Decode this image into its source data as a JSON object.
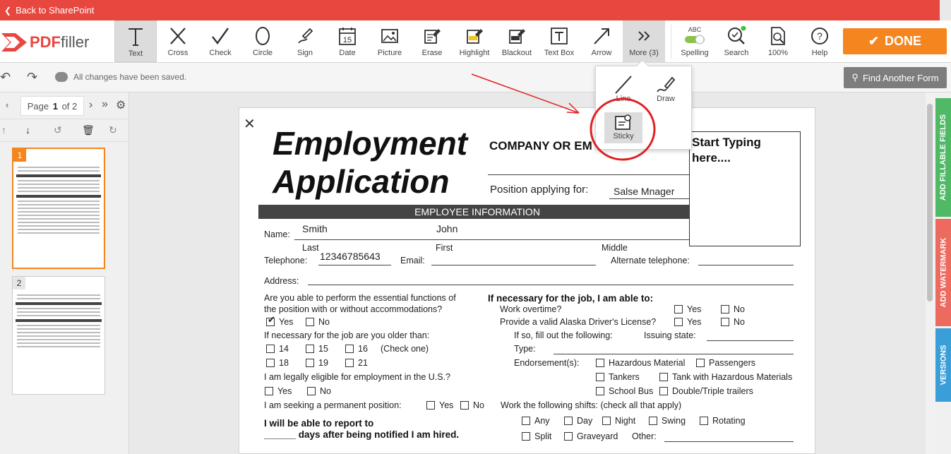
{
  "topbar": {
    "back_label": "Back to SharePoint"
  },
  "brand": {
    "pdf": "PDF",
    "filler": "filler"
  },
  "tools": [
    {
      "label": "Text",
      "icon": "text-icon"
    },
    {
      "label": "Cross",
      "icon": "cross-icon"
    },
    {
      "label": "Check",
      "icon": "check-icon"
    },
    {
      "label": "Circle",
      "icon": "circle-icon"
    },
    {
      "label": "Sign",
      "icon": "sign-icon"
    },
    {
      "label": "Date",
      "icon": "date-icon"
    },
    {
      "label": "Picture",
      "icon": "picture-icon"
    },
    {
      "label": "Erase",
      "icon": "erase-icon"
    },
    {
      "label": "Highlight",
      "icon": "highlight-icon"
    },
    {
      "label": "Blackout",
      "icon": "blackout-icon"
    },
    {
      "label": "Text Box",
      "icon": "textbox-icon"
    },
    {
      "label": "Arrow",
      "icon": "arrow-icon"
    },
    {
      "label": "More (3)",
      "icon": "more-icon"
    }
  ],
  "right_tools": [
    {
      "label": "Spelling",
      "icon": "spelling-icon",
      "badge": "ABC"
    },
    {
      "label": "Search",
      "icon": "search-icon"
    },
    {
      "label": "100%",
      "icon": "zoom-icon"
    },
    {
      "label": "Help",
      "icon": "help-icon"
    }
  ],
  "date_icon_number": "15",
  "done_label": "DONE",
  "status_text": "All changes have been saved.",
  "find_label": "Find Another Form",
  "pager": {
    "prefix": "Page",
    "current": "1",
    "suffix": "of 2"
  },
  "thumbnails": [
    {
      "num": "1"
    },
    {
      "num": "2"
    }
  ],
  "more_menu": [
    {
      "label": "Line",
      "icon": "line-icon"
    },
    {
      "label": "Draw",
      "icon": "draw-icon"
    },
    {
      "label": "Sticky",
      "icon": "sticky-icon"
    }
  ],
  "side_tabs": [
    {
      "label": "ADD FILLABLE FIELDS",
      "color": "#4fb966"
    },
    {
      "label": "ADD WATERMARK",
      "color": "#ec6a5e"
    },
    {
      "label": "VERSIONS",
      "color": "#3a9fd8"
    }
  ],
  "doc": {
    "title_line1": "Employment",
    "title_line2": "Application",
    "company_label": "COMPANY OR EM",
    "position_label": "Position applying for:",
    "position_value": "Salse Mnager",
    "typing_box": "Start Typing here....",
    "section_header": "EMPLOYEE INFORMATION",
    "name_label": "Name:",
    "last_value": "Smith",
    "first_value": "John",
    "last_label": "Last",
    "first_label": "First",
    "middle_label": "Middle",
    "telephone_label": "Telephone:",
    "telephone_value": "12346785643",
    "email_label": "Email:",
    "alt_phone_label": "Alternate telephone:",
    "address_label": "Address:",
    "q1_line1": "Are you able to perform the essential functions of",
    "q1_line2": "the position with or without accommodations?",
    "yes": "Yes",
    "no": "No",
    "q2": "If necessary for the job are you older than:",
    "ages": [
      "14",
      "15",
      "16",
      "18",
      "19",
      "21"
    ],
    "check_one": "(Check one)",
    "q3": "I am legally eligible for employment in the U.S.?",
    "q4": "I am seeking a permanent position:",
    "report_line1": "I will be able to report to",
    "report_line2": "______ days after being notified I am hired.",
    "right_header": "If necessary for the job, I am able to:",
    "overtime": "Work overtime?",
    "license": "Provide a valid Alaska Driver's License?",
    "if_so": "If so, fill out the following:",
    "issuing_state": "Issuing state:",
    "type_label": "Type:",
    "endorsements_label": "Endorsement(s):",
    "endorsements": [
      "Hazardous Material",
      "Passengers",
      "Tankers",
      "Tank with Hazardous Materials",
      "School Bus",
      "Double/Triple trailers"
    ],
    "shifts_label": "Work the following shifts: (check all that apply)",
    "shifts": [
      "Any",
      "Day",
      "Night",
      "Swing",
      "Rotating",
      "Split",
      "Graveyard"
    ],
    "other_label": "Other:"
  },
  "colors": {
    "brand_red": "#e8473f",
    "done_orange": "#f5851f",
    "annotation_red": "#e02020"
  }
}
